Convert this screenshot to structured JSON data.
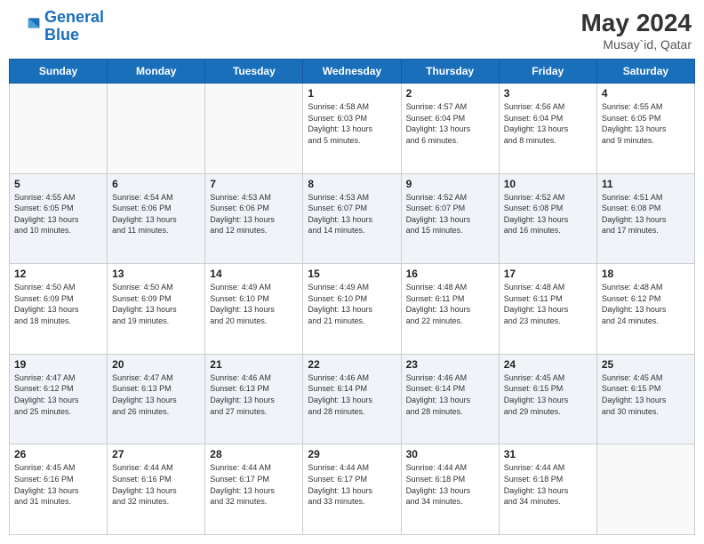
{
  "header": {
    "logo_line1": "General",
    "logo_line2": "Blue",
    "month_title": "May 2024",
    "location": "Musay`id, Qatar"
  },
  "weekdays": [
    "Sunday",
    "Monday",
    "Tuesday",
    "Wednesday",
    "Thursday",
    "Friday",
    "Saturday"
  ],
  "weeks": [
    [
      {
        "day": "",
        "info": ""
      },
      {
        "day": "",
        "info": ""
      },
      {
        "day": "",
        "info": ""
      },
      {
        "day": "1",
        "info": "Sunrise: 4:58 AM\nSunset: 6:03 PM\nDaylight: 13 hours\nand 5 minutes."
      },
      {
        "day": "2",
        "info": "Sunrise: 4:57 AM\nSunset: 6:04 PM\nDaylight: 13 hours\nand 6 minutes."
      },
      {
        "day": "3",
        "info": "Sunrise: 4:56 AM\nSunset: 6:04 PM\nDaylight: 13 hours\nand 8 minutes."
      },
      {
        "day": "4",
        "info": "Sunrise: 4:55 AM\nSunset: 6:05 PM\nDaylight: 13 hours\nand 9 minutes."
      }
    ],
    [
      {
        "day": "5",
        "info": "Sunrise: 4:55 AM\nSunset: 6:05 PM\nDaylight: 13 hours\nand 10 minutes."
      },
      {
        "day": "6",
        "info": "Sunrise: 4:54 AM\nSunset: 6:06 PM\nDaylight: 13 hours\nand 11 minutes."
      },
      {
        "day": "7",
        "info": "Sunrise: 4:53 AM\nSunset: 6:06 PM\nDaylight: 13 hours\nand 12 minutes."
      },
      {
        "day": "8",
        "info": "Sunrise: 4:53 AM\nSunset: 6:07 PM\nDaylight: 13 hours\nand 14 minutes."
      },
      {
        "day": "9",
        "info": "Sunrise: 4:52 AM\nSunset: 6:07 PM\nDaylight: 13 hours\nand 15 minutes."
      },
      {
        "day": "10",
        "info": "Sunrise: 4:52 AM\nSunset: 6:08 PM\nDaylight: 13 hours\nand 16 minutes."
      },
      {
        "day": "11",
        "info": "Sunrise: 4:51 AM\nSunset: 6:08 PM\nDaylight: 13 hours\nand 17 minutes."
      }
    ],
    [
      {
        "day": "12",
        "info": "Sunrise: 4:50 AM\nSunset: 6:09 PM\nDaylight: 13 hours\nand 18 minutes."
      },
      {
        "day": "13",
        "info": "Sunrise: 4:50 AM\nSunset: 6:09 PM\nDaylight: 13 hours\nand 19 minutes."
      },
      {
        "day": "14",
        "info": "Sunrise: 4:49 AM\nSunset: 6:10 PM\nDaylight: 13 hours\nand 20 minutes."
      },
      {
        "day": "15",
        "info": "Sunrise: 4:49 AM\nSunset: 6:10 PM\nDaylight: 13 hours\nand 21 minutes."
      },
      {
        "day": "16",
        "info": "Sunrise: 4:48 AM\nSunset: 6:11 PM\nDaylight: 13 hours\nand 22 minutes."
      },
      {
        "day": "17",
        "info": "Sunrise: 4:48 AM\nSunset: 6:11 PM\nDaylight: 13 hours\nand 23 minutes."
      },
      {
        "day": "18",
        "info": "Sunrise: 4:48 AM\nSunset: 6:12 PM\nDaylight: 13 hours\nand 24 minutes."
      }
    ],
    [
      {
        "day": "19",
        "info": "Sunrise: 4:47 AM\nSunset: 6:12 PM\nDaylight: 13 hours\nand 25 minutes."
      },
      {
        "day": "20",
        "info": "Sunrise: 4:47 AM\nSunset: 6:13 PM\nDaylight: 13 hours\nand 26 minutes."
      },
      {
        "day": "21",
        "info": "Sunrise: 4:46 AM\nSunset: 6:13 PM\nDaylight: 13 hours\nand 27 minutes."
      },
      {
        "day": "22",
        "info": "Sunrise: 4:46 AM\nSunset: 6:14 PM\nDaylight: 13 hours\nand 28 minutes."
      },
      {
        "day": "23",
        "info": "Sunrise: 4:46 AM\nSunset: 6:14 PM\nDaylight: 13 hours\nand 28 minutes."
      },
      {
        "day": "24",
        "info": "Sunrise: 4:45 AM\nSunset: 6:15 PM\nDaylight: 13 hours\nand 29 minutes."
      },
      {
        "day": "25",
        "info": "Sunrise: 4:45 AM\nSunset: 6:15 PM\nDaylight: 13 hours\nand 30 minutes."
      }
    ],
    [
      {
        "day": "26",
        "info": "Sunrise: 4:45 AM\nSunset: 6:16 PM\nDaylight: 13 hours\nand 31 minutes."
      },
      {
        "day": "27",
        "info": "Sunrise: 4:44 AM\nSunset: 6:16 PM\nDaylight: 13 hours\nand 32 minutes."
      },
      {
        "day": "28",
        "info": "Sunrise: 4:44 AM\nSunset: 6:17 PM\nDaylight: 13 hours\nand 32 minutes."
      },
      {
        "day": "29",
        "info": "Sunrise: 4:44 AM\nSunset: 6:17 PM\nDaylight: 13 hours\nand 33 minutes."
      },
      {
        "day": "30",
        "info": "Sunrise: 4:44 AM\nSunset: 6:18 PM\nDaylight: 13 hours\nand 34 minutes."
      },
      {
        "day": "31",
        "info": "Sunrise: 4:44 AM\nSunset: 6:18 PM\nDaylight: 13 hours\nand 34 minutes."
      },
      {
        "day": "",
        "info": ""
      }
    ]
  ]
}
